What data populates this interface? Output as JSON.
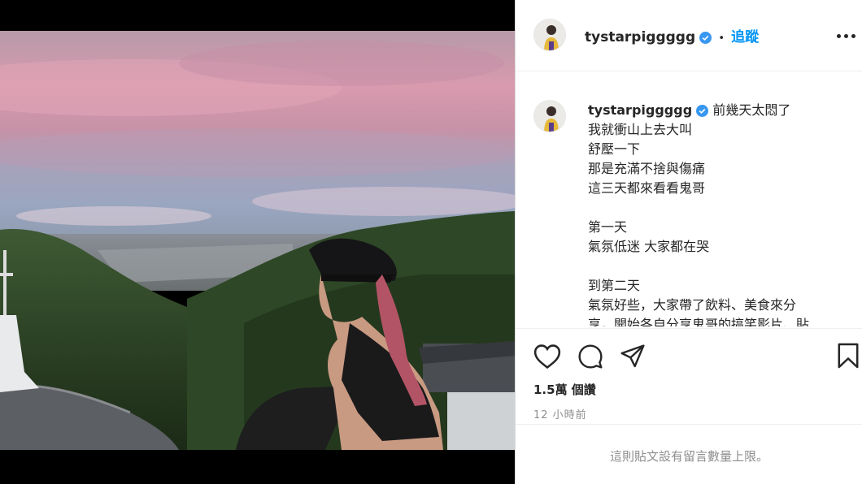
{
  "post": {
    "username": "tystarpiggggg",
    "follow_label": "追蹤",
    "separator": "•",
    "caption_lines": [
      "前幾天太悶了",
      "我就衝山上去大叫",
      "舒壓一下",
      "那是充滿不捨與傷痛",
      "這三天都來看看鬼哥",
      "",
      "第一天",
      "氣氛低迷 大家都在哭",
      "",
      "到第二天",
      "氣氛好些，大家帶了飲料、美食來分",
      "享，開始各自分享鬼哥的搞笑影片、貼"
    ],
    "views": "1.5萬 個讚",
    "time_ago": "12 小時前",
    "comments_disabled": "這則貼文設有留言數量上限。"
  },
  "icons": [
    "heart-icon",
    "comment-icon",
    "share-icon",
    "bookmark-icon",
    "more-icon",
    "verified-badge-icon"
  ],
  "colors": {
    "accent": "#0095f6",
    "text": "#262626",
    "muted": "#8e8e8e",
    "border": "#dbdbdb"
  }
}
